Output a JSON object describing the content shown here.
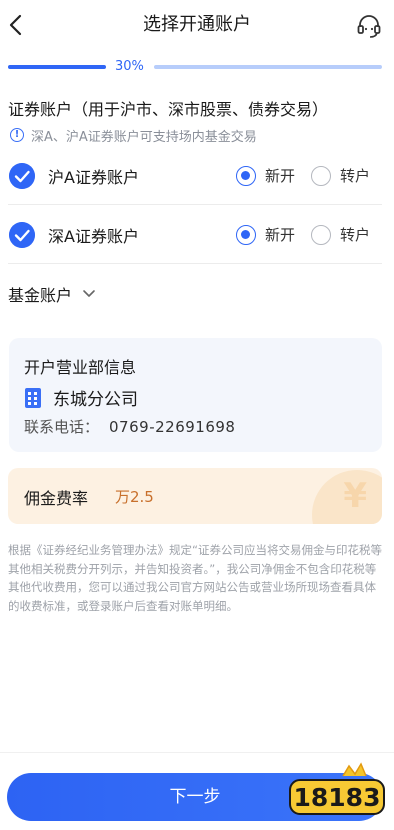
{
  "header": {
    "title": "选择开通账户"
  },
  "progress": {
    "value_percent": 30,
    "label": "30%"
  },
  "securities": {
    "title": "证券账户（用于沪市、深市股票、债券交易）",
    "notice": "深A、沪A证券账户可支持场内基金交易",
    "accounts": [
      {
        "label": "沪A证券账户",
        "checked": true,
        "option_new": "新开",
        "option_transfer": "转户",
        "selected": "新开"
      },
      {
        "label": "深A证券账户",
        "checked": true,
        "option_new": "新开",
        "option_transfer": "转户",
        "selected": "新开"
      }
    ]
  },
  "fund": {
    "label": "基金账户"
  },
  "branch": {
    "heading": "开户营业部信息",
    "name": "东城分公司",
    "phone_label": "联系电话：",
    "phone": "0769-22691698"
  },
  "fee": {
    "label": "佣金费率",
    "value": "万2.5",
    "coin_symbol": "¥"
  },
  "disclaimer": "根据《证券经纪业务管理办法》规定“证券公司应当将交易佣金与印花税等其他相关税费分开列示，并告知投资者。”，我公司净佣金不包含印花税等其他代收费用，您可以通过我公司官方网站公告或营业场所现场查看具体的收费标准，或登录账户后查看对账单明细。",
  "footer": {
    "next_label": "下一步"
  },
  "watermark": {
    "text": "18183"
  },
  "colors": {
    "accent": "#2f66f6",
    "fee_text": "#c8702c",
    "fee_bg": "#fdf1e2",
    "card_bg": "#f3f6fc"
  }
}
